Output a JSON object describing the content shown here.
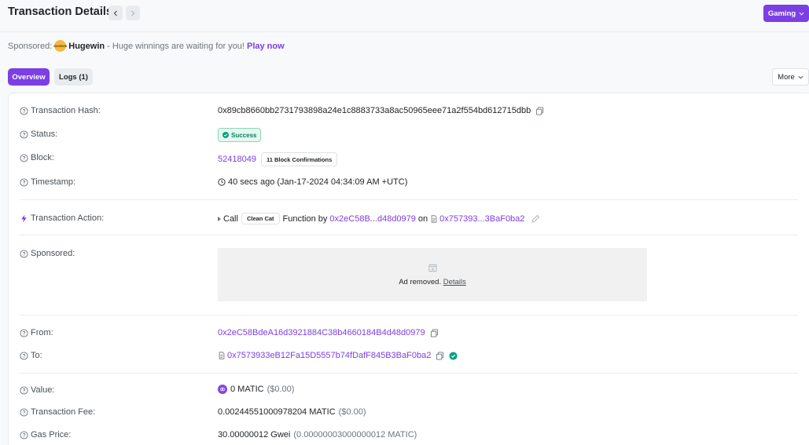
{
  "header": {
    "title": "Transaction Details",
    "gaming_label": "Gaming"
  },
  "sponsor": {
    "prefix": "Sponsored:",
    "logo_text": "HUGEWIN",
    "brand": "Hugewin",
    "message": "- Huge winnings are waiting for you!",
    "cta": "Play now"
  },
  "tabs": [
    {
      "label": "Overview",
      "active": true
    },
    {
      "label": "Logs (1)",
      "active": false
    }
  ],
  "more_label": "More",
  "rows": {
    "hash": {
      "label": "Transaction Hash:",
      "value": "0x89cb8660bb2731793898a24e1c8883733a8ac50965eee71a2f554bd612715dbb"
    },
    "status": {
      "label": "Status:",
      "value": "Success"
    },
    "block": {
      "label": "Block:",
      "value": "52418049",
      "confirmations": "11 Block Confirmations"
    },
    "timestamp": {
      "label": "Timestamp:",
      "value": "40 secs ago (Jan-17-2024 04:34:09 AM +UTC)"
    },
    "action": {
      "label": "Transaction Action:",
      "call": "Call",
      "method": "Clean Cat",
      "function_by": "Function by",
      "from_short": "0x2eC58B...d48d0979",
      "on": "on",
      "contract_short": "0x757393...3BaF0ba2"
    },
    "sponsored": {
      "label": "Sponsored:",
      "ad_text": "Ad removed.",
      "ad_link": "Details"
    },
    "from": {
      "label": "From:",
      "value": "0x2eC58BdeA16d3921884C38b4660184B4d48d0979"
    },
    "to": {
      "label": "To:",
      "value": "0x7573933eB12Fa15D5557b74fDafF845B3BaF0ba2"
    },
    "value": {
      "label": "Value:",
      "amount": "0 MATIC",
      "usd": "($0.00)"
    },
    "fee": {
      "label": "Transaction Fee:",
      "amount": "0.00244551000978204 MATIC",
      "usd": "($0.00)"
    },
    "gas": {
      "label": "Gas Price:",
      "amount": "30.00000012 Gwei",
      "detail": "(0.00000003000000012 MATIC)"
    }
  },
  "colors": {
    "accent": "#7b3fe4",
    "success": "#00855d"
  }
}
